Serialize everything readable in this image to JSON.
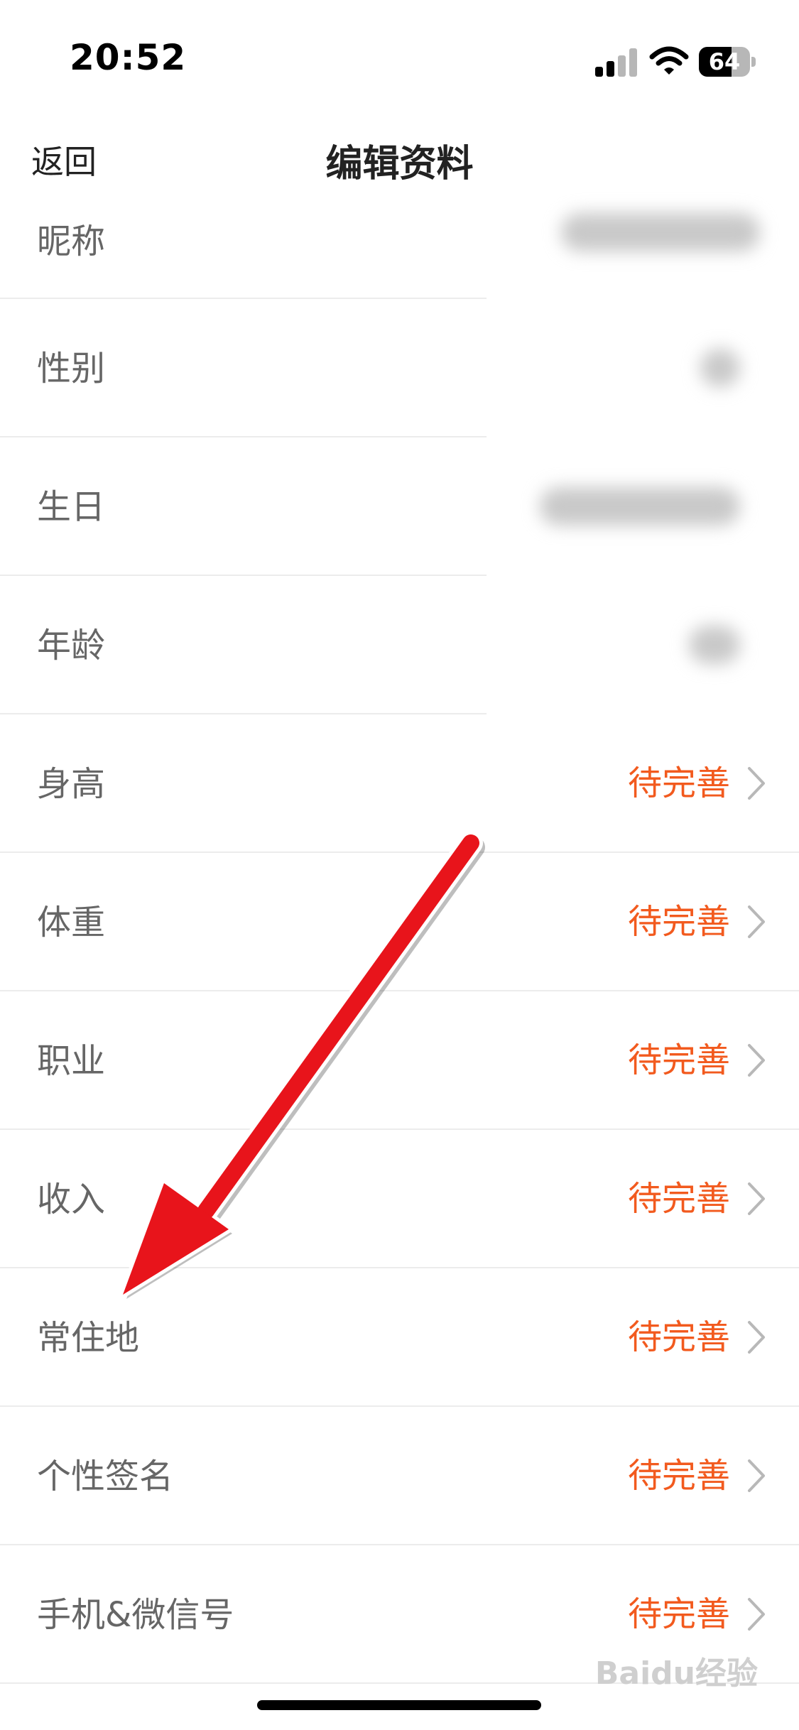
{
  "status_bar": {
    "time": "20:52",
    "battery_level": "64",
    "icons": [
      "signal-icon",
      "wifi-icon",
      "battery-icon"
    ]
  },
  "nav": {
    "back_label": "返回",
    "title": "编辑资料"
  },
  "rows": [
    {
      "label": "昵称"
    },
    {
      "label": "性别"
    },
    {
      "label": "生日"
    },
    {
      "label": "年龄"
    },
    {
      "label": "身高",
      "value": "待完善"
    },
    {
      "label": "体重",
      "value": "待完善"
    },
    {
      "label": "职业",
      "value": "待完善"
    },
    {
      "label": "收入",
      "value": "待完善"
    },
    {
      "label": "常住地",
      "value": "待完善"
    },
    {
      "label": "个性签名",
      "value": "待完善"
    },
    {
      "label": "手机&微信号",
      "value": "待完善"
    }
  ],
  "watermark": "Baidu经验",
  "colors": {
    "accent": "#f25a1e",
    "label": "#666666",
    "arrow": "#e8141b"
  }
}
